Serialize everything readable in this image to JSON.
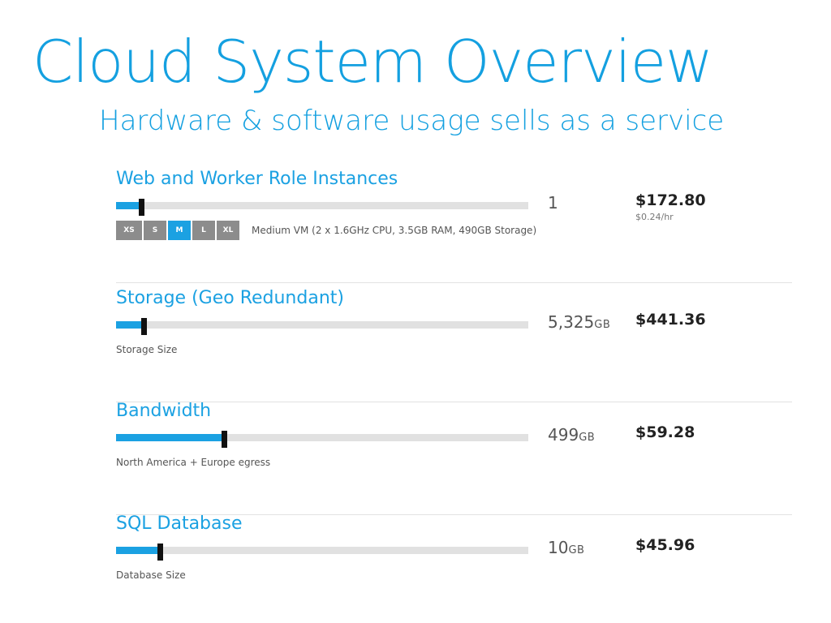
{
  "header": {
    "title": "Cloud System Overview",
    "subtitle": "Hardware & software usage sells as a service"
  },
  "colors": {
    "accent": "#1ba1e2",
    "track": "#e1e1e1",
    "thumb": "#111111",
    "size_inactive": "#8c8c8c"
  },
  "services": [
    {
      "name": "Web and Worker Role Instances",
      "quantity": "1",
      "unit": "",
      "price": "$172.80",
      "rate": "$0.24/hr",
      "slider_fraction": 0.057,
      "sizes": [
        {
          "label": "XS",
          "selected": false
        },
        {
          "label": "S",
          "selected": false
        },
        {
          "label": "M",
          "selected": true
        },
        {
          "label": "L",
          "selected": false
        },
        {
          "label": "XL",
          "selected": false
        }
      ],
      "size_description": "Medium VM (2 x 1.6GHz CPU, 3.5GB RAM, 490GB Storage)"
    },
    {
      "name": "Storage (Geo Redundant)",
      "quantity": "5,325",
      "unit": "GB",
      "price": "$441.36",
      "slider_fraction": 0.063,
      "caption": "Storage Size"
    },
    {
      "name": "Bandwidth",
      "quantity": "499",
      "unit": "GB",
      "price": "$59.28",
      "slider_fraction": 0.258,
      "caption": "North America + Europe egress"
    },
    {
      "name": "SQL Database",
      "quantity": "10",
      "unit": "GB",
      "price": "$45.96",
      "slider_fraction": 0.102,
      "caption": "Database Size"
    }
  ]
}
